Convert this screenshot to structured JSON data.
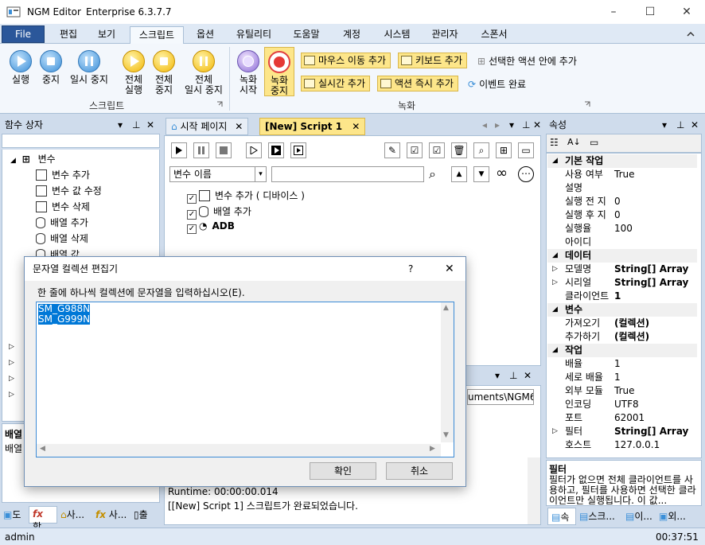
{
  "window": {
    "app_name": "NGM Editor",
    "edition": "Enterprise 6.3.7.7"
  },
  "menu": {
    "file": "File",
    "items": [
      "편집",
      "보기",
      "스크립트",
      "옵션",
      "유틸리티",
      "도움말",
      "계정",
      "시스템",
      "관리자",
      "스폰서"
    ]
  },
  "ribbon": {
    "script_group": {
      "label": "스크립트",
      "run": "실행",
      "stop": "중지",
      "pause": "일시 중지",
      "run_all_1": "전체",
      "run_all_2": "실행",
      "stop_all_1": "전체",
      "stop_all_2": "중지",
      "pause_all_1": "전체",
      "pause_all_2": "일시 중지"
    },
    "record_group": {
      "label": "녹화",
      "record_start_1": "녹화",
      "record_start_2": "시작",
      "record_stop_1": "녹화",
      "record_stop_2": "중지",
      "mouse_move": "마우스 이동 추가",
      "keyboard": "키보드 추가",
      "add_in_selected": "선택한 액션 안에 추가",
      "realtime": "실시간 추가",
      "action_now": "액션 즉시 추가",
      "event_done": "이벤트 완료"
    }
  },
  "function_box": {
    "title": "함수 상자",
    "root": "변수",
    "items": [
      "변수 추가",
      "변수 값 수정",
      "변수 삭제",
      "배열 추가",
      "배열 삭제",
      "배열 값"
    ],
    "desc_title": "배열",
    "desc_text": "배열"
  },
  "doc_tabs": {
    "start_page": "시작 페이지",
    "script1": "[New] Script 1"
  },
  "script": {
    "var_dropdown": "변수 이름",
    "actions": [
      "변수 추가 ( 디바이스 )",
      "배열 추가",
      "ADB"
    ]
  },
  "output": {
    "path_fragment": "uments\\NGM6\\",
    "runtime": "Runtime: 00:00:00.014",
    "done": "[[New] Script 1] 스크립트가 완료되었습니다."
  },
  "properties": {
    "title": "속성",
    "cat_basic": "기본 작업",
    "rows_basic": [
      [
        "사용 여부",
        "True"
      ],
      [
        "설명",
        ""
      ],
      [
        "실행 전 지",
        "0"
      ],
      [
        "실행 후 지",
        "0"
      ],
      [
        "실행율",
        "100"
      ],
      [
        "아이디",
        ""
      ]
    ],
    "cat_data": "데이터",
    "rows_data": [
      [
        "모델명",
        "String[] Array"
      ],
      [
        "시리얼",
        "String[] Array"
      ],
      [
        "클라이언트",
        "1"
      ]
    ],
    "cat_var": "변수",
    "rows_var": [
      [
        "가져오기",
        "(컬렉션)"
      ],
      [
        "추가하기",
        "(컬렉션)"
      ]
    ],
    "cat_work": "작업",
    "rows_work": [
      [
        "배율",
        "1"
      ],
      [
        "세로 배율",
        "1"
      ],
      [
        "외부 모듈",
        "True"
      ],
      [
        "인코딩",
        "UTF8"
      ],
      [
        "포트",
        "62001"
      ],
      [
        "필터",
        "String[] Array"
      ],
      [
        "호스트",
        "127.0.0.1"
      ]
    ],
    "desc_title": "필터",
    "desc_text": "필터가 없으면 전체 클라이언트를 사용하고, 필터를 사용하면 선택한 클라이언트만 실행됩니다. 이 값..."
  },
  "bottom_tabs_left": [
    "도",
    "함",
    "사...",
    "사...",
    "출"
  ],
  "bottom_tabs_right": [
    "속",
    "스크...",
    "이...",
    "외..."
  ],
  "status_bar": {
    "user": "admin",
    "time": "00:37:51"
  },
  "dialog": {
    "title": "문자열 컬렉션 편집기",
    "help": "?",
    "instruction": "한 줄에 하나씩 컬렉션에 문자열을 입력하십시오(E).",
    "lines": [
      "SM_G988N",
      "SM_G999N"
    ],
    "ok": "확인",
    "cancel": "취소"
  },
  "colors": {
    "accent": "#2b579a",
    "selection": "#0078d7",
    "highlight": "#fde68a"
  }
}
